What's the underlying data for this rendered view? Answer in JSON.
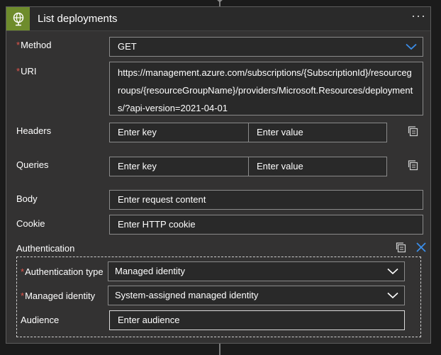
{
  "action": {
    "title": "List deployments",
    "more_label": "···"
  },
  "fields": {
    "method": {
      "label": "Method",
      "value": "GET"
    },
    "uri": {
      "label": "URI",
      "value": "https://management.azure.com/subscriptions/{SubscriptionId}/resourcegroups/{resourceGroupName}/providers/Microsoft.Resources/deployments/?api-version=2021-04-01"
    },
    "headers": {
      "label": "Headers",
      "key_placeholder": "Enter key",
      "value_placeholder": "Enter value"
    },
    "queries": {
      "label": "Queries",
      "key_placeholder": "Enter key",
      "value_placeholder": "Enter value"
    },
    "body": {
      "label": "Body",
      "placeholder": "Enter request content"
    },
    "cookie": {
      "label": "Cookie",
      "placeholder": "Enter HTTP cookie"
    }
  },
  "authentication": {
    "label": "Authentication",
    "type": {
      "label": "Authentication type",
      "value": "Managed identity"
    },
    "identity": {
      "label": "Managed identity",
      "value": "System-assigned managed identity"
    },
    "audience": {
      "label": "Audience",
      "placeholder": "Enter audience"
    }
  },
  "colors": {
    "accent": "#6e8c2c",
    "required": "#e0544b",
    "link_blue": "#3b8eea"
  }
}
